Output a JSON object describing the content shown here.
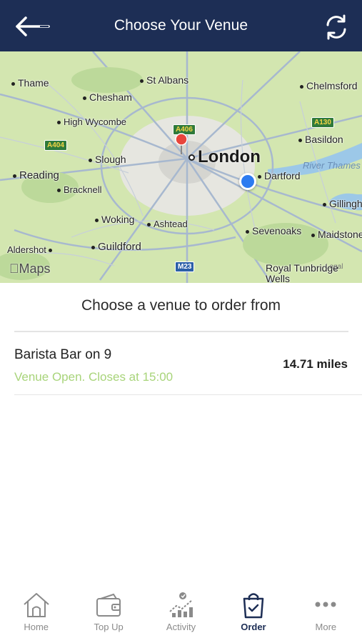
{
  "header": {
    "title": "Choose Your Venue",
    "back_icon": "arrow-left-icon",
    "refresh_icon": "refresh-icon",
    "background": "#1d2e55"
  },
  "map": {
    "attribution": "Maps",
    "legal": "Legal",
    "places": {
      "thame": "Thame",
      "st_albans": "St Albans",
      "chelmsford": "Chelmsford",
      "chesham": "Chesham",
      "high_wycombe": "High Wycombe",
      "basildon": "Basildon",
      "slough": "Slough",
      "london": "London",
      "reading": "Reading",
      "dartford": "Dartford",
      "river_thames": "River Thames",
      "bracknell": "Bracknell",
      "gillingham": "Gillingham",
      "woking": "Woking",
      "ashtead": "Ashtead",
      "sevenoaks": "Sevenoaks",
      "maidstone": "Maidstone",
      "aldershot": "Aldershot",
      "guildford": "Guildford",
      "royal_tunbridge_wells": "Royal Tunbridge Wells"
    },
    "road_signs": {
      "a404": "A404",
      "a406": "A406",
      "a130": "A130",
      "m23": "M23"
    },
    "user_location_color": "#2d7bf0",
    "pin_color": "#e8453c"
  },
  "content": {
    "heading": "Choose a venue to order from",
    "venues": [
      {
        "name": "Barista Bar on 9",
        "status": "Venue Open. Closes at 15:00",
        "distance": "14.71 miles",
        "status_color": "#a8d47a"
      }
    ]
  },
  "tabbar": {
    "tabs": [
      {
        "label": "Home",
        "icon": "home-icon",
        "active": false
      },
      {
        "label": "Top Up",
        "icon": "wallet-icon",
        "active": false
      },
      {
        "label": "Activity",
        "icon": "activity-chart-icon",
        "active": false
      },
      {
        "label": "Order",
        "icon": "shopping-bag-icon",
        "active": true
      },
      {
        "label": "More",
        "icon": "more-dots-icon",
        "active": false
      }
    ]
  }
}
